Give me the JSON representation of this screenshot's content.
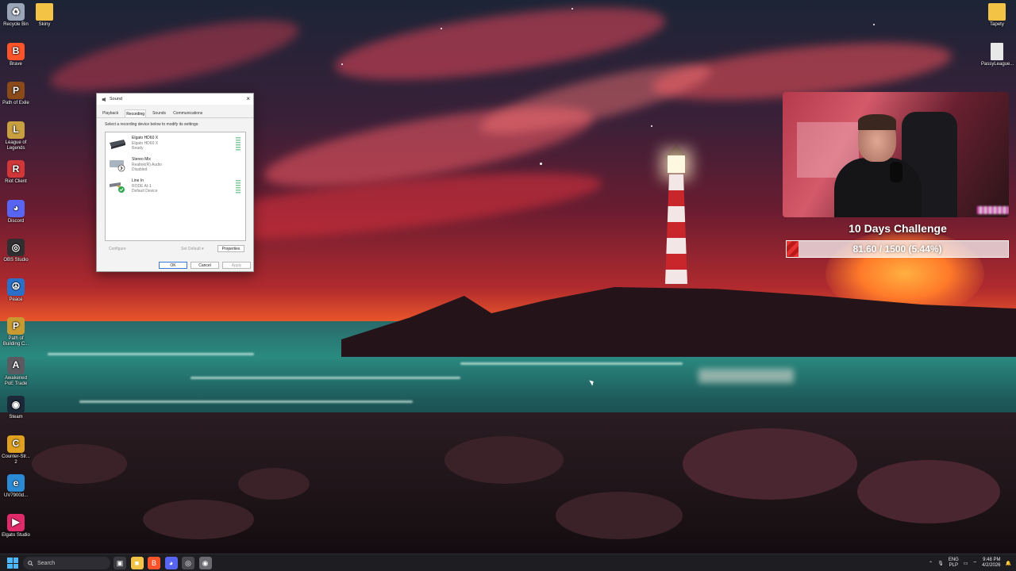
{
  "desktop": {
    "icons_left": [
      {
        "label": "Recycle Bin",
        "icon": "recycle-bin-icon",
        "color": "#9aa6b8"
      },
      {
        "label": "Brave",
        "icon": "brave-icon",
        "color": "#fb542b"
      },
      {
        "label": "Path of Exile",
        "icon": "poe-icon",
        "color": "#8a4a1a"
      },
      {
        "label": "League of Legends",
        "icon": "lol-icon",
        "color": "#c8a040"
      },
      {
        "label": "Riot Client",
        "icon": "riot-icon",
        "color": "#d13639"
      },
      {
        "label": "Discord",
        "icon": "discord-icon",
        "color": "#5865f2"
      },
      {
        "label": "OBS Studio",
        "icon": "obs-icon",
        "color": "#302e31"
      },
      {
        "label": "Peace",
        "icon": "peace-icon",
        "color": "#2a70c8"
      },
      {
        "label": "Path of Building C...",
        "icon": "pob-icon",
        "color": "#c89a30"
      },
      {
        "label": "Awakened PoE Trade",
        "icon": "apt-icon",
        "color": "#5a5a60"
      },
      {
        "label": "Steam",
        "icon": "steam-icon",
        "color": "#1b2838"
      },
      {
        "label": "Counter-Str... 2",
        "icon": "cs2-icon",
        "color": "#e0a020"
      },
      {
        "label": "UV7900d...",
        "icon": "edge-icon",
        "color": "#2a8ad4"
      },
      {
        "label": "Elgato Studio",
        "icon": "elgato-icon",
        "color": "#e02a6a"
      }
    ],
    "icon_folder": {
      "label": "Skiny",
      "icon": "folder-icon",
      "color": "#f2c344"
    },
    "icons_right": [
      {
        "label": "Tapety",
        "icon": "folder-icon",
        "color": "#f2c344"
      },
      {
        "label": "PassyLeague...",
        "icon": "file-icon",
        "color": "#e8e8e8"
      }
    ]
  },
  "sound_dialog": {
    "title": "Sound",
    "tabs": [
      "Playback",
      "Recording",
      "Sounds",
      "Communications"
    ],
    "active_tab": 1,
    "instruction": "Select a recording device below to modify its settings:",
    "devices": [
      {
        "name": "Elgato HD60 X",
        "line2": "Elgato HD60 X",
        "status": "Ready",
        "icon": "capture-card-icon"
      },
      {
        "name": "Stereo Mix",
        "line2": "Realtek(R) Audio",
        "status": "Disabled",
        "icon": "stereo-mix-icon"
      },
      {
        "name": "Line In",
        "line2": "RODE AI-1",
        "status": "Default Device",
        "icon": "line-in-icon"
      }
    ],
    "configure": "Configure",
    "set_default": "Set Default",
    "properties": "Properties",
    "ok": "OK",
    "cancel": "Cancel",
    "apply": "Apply"
  },
  "overlay": {
    "title": "10 Days Challenge",
    "progress_text": "81.60 / 1500 (5.44%)",
    "progress_fraction": 0.0544,
    "fill_color": "#e83030"
  },
  "taskbar": {
    "search_placeholder": "Search",
    "apps": [
      {
        "name": "task-view-icon",
        "color": "#3a3a40"
      },
      {
        "name": "file-explorer-icon",
        "color": "#f2c344"
      },
      {
        "name": "brave-icon",
        "color": "#fb542b"
      },
      {
        "name": "discord-icon",
        "color": "#5865f2"
      },
      {
        "name": "obs-icon",
        "color": "#4a4a50"
      },
      {
        "name": "steam-icon",
        "color": "#6a6a70"
      }
    ],
    "lang_top": "ENG",
    "lang_bottom": "PLP",
    "time": "9:48 PM",
    "date": "4/2/2026"
  }
}
